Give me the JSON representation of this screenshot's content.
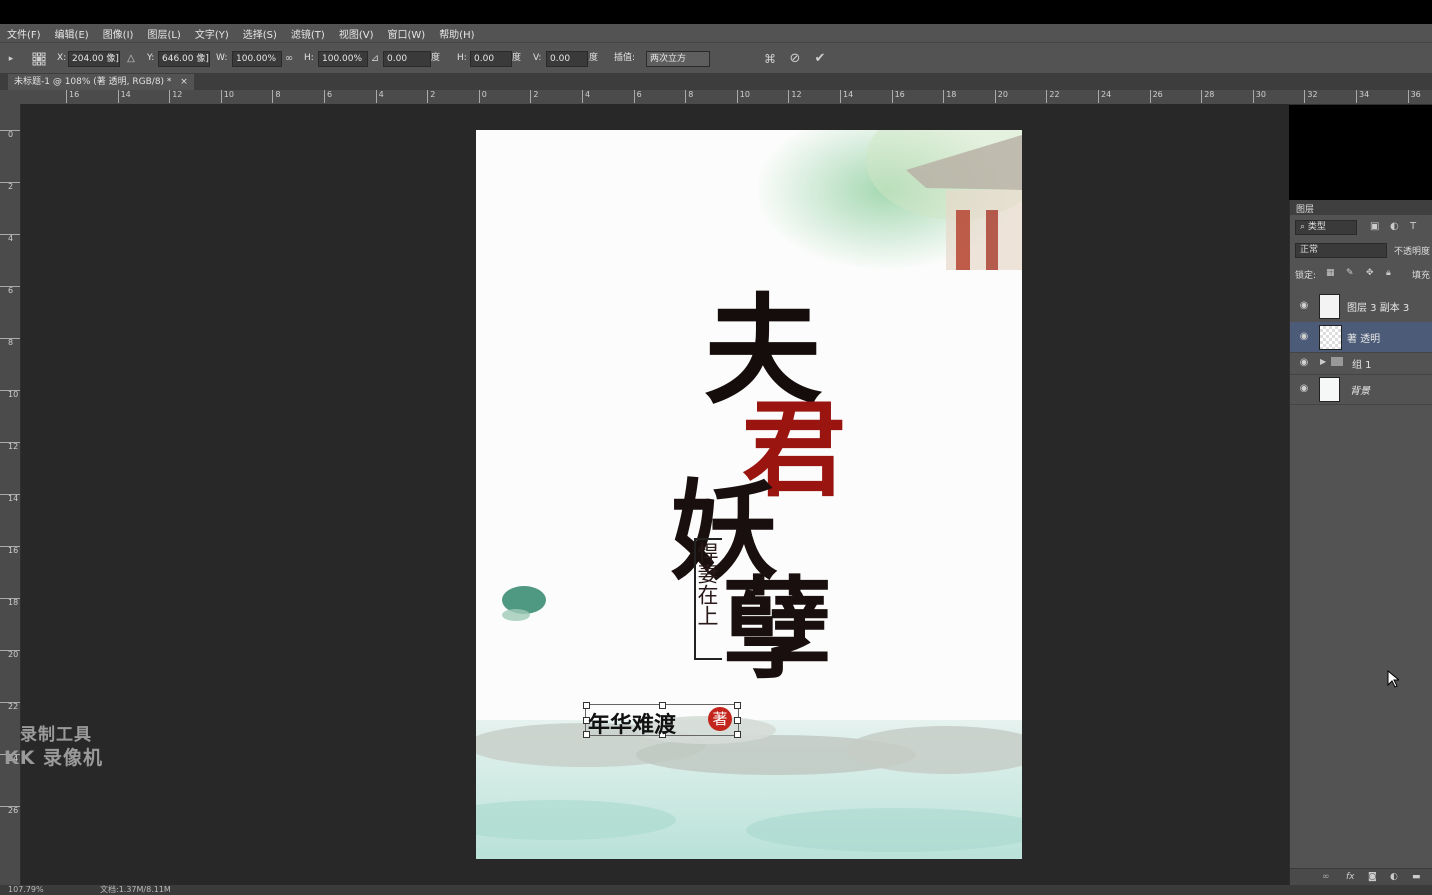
{
  "menu": [
    "文件(F)",
    "编辑(E)",
    "图像(I)",
    "图层(L)",
    "文字(Y)",
    "选择(S)",
    "滤镜(T)",
    "视图(V)",
    "窗口(W)",
    "帮助(H)"
  ],
  "options": {
    "x_label": "X:",
    "x_value": "204.00 像]",
    "y_label": "Y:",
    "y_value": "646.00 像]",
    "w_label": "W:",
    "w_value": "100.00%",
    "h_label": "H:",
    "h_value": "100.00%",
    "angle_value": "0.00",
    "angle_unit": "度",
    "hskew_label": "H:",
    "hskew_value": "0.00",
    "hskew_unit": "度",
    "vskew_label": "V:",
    "vskew_value": "0.00",
    "vskew_unit": "度",
    "interp_label": "插值:",
    "interp_value": "两次立方"
  },
  "document_tab": "未标题-1 @ 108% (著 透明, RGB/8) *",
  "document_tab_close": "×",
  "hruler_ticks": [
    "16",
    "14",
    "12",
    "10",
    "8",
    "6",
    "4",
    "2",
    "0",
    "2",
    "4",
    "6",
    "8",
    "10",
    "12",
    "14",
    "16",
    "18",
    "20",
    "22",
    "24",
    "26",
    "28",
    "30",
    "32",
    "34",
    "36"
  ],
  "vruler_ticks": [
    "0",
    "2",
    "4",
    "6",
    "8",
    "10",
    "12",
    "14",
    "16",
    "18",
    "20",
    "22",
    "24",
    "26"
  ],
  "canvas": {
    "title_chars": [
      "夫",
      "君",
      "妖",
      "孽"
    ],
    "subtitle": "悍妻在上",
    "author": "年华难渡",
    "author_seal": "著"
  },
  "layers_panel": {
    "title": "图层",
    "filter_type": "类型",
    "blend_mode": "正常",
    "opacity_label": "不透明度",
    "lock_label": "锁定:",
    "fill_label": "填充",
    "layers": [
      {
        "name": "图层 3 副本 3",
        "selected": false
      },
      {
        "name": "著 透明",
        "selected": true
      },
      {
        "name": "组 1",
        "selected": false
      },
      {
        "name": "背景",
        "selected": false
      }
    ]
  },
  "status": {
    "zoom": "107.79%",
    "doc_info": "文档:1.37M/8.11M"
  },
  "watermark": {
    "line1": "录制工具",
    "line2": "KK 录像机"
  }
}
